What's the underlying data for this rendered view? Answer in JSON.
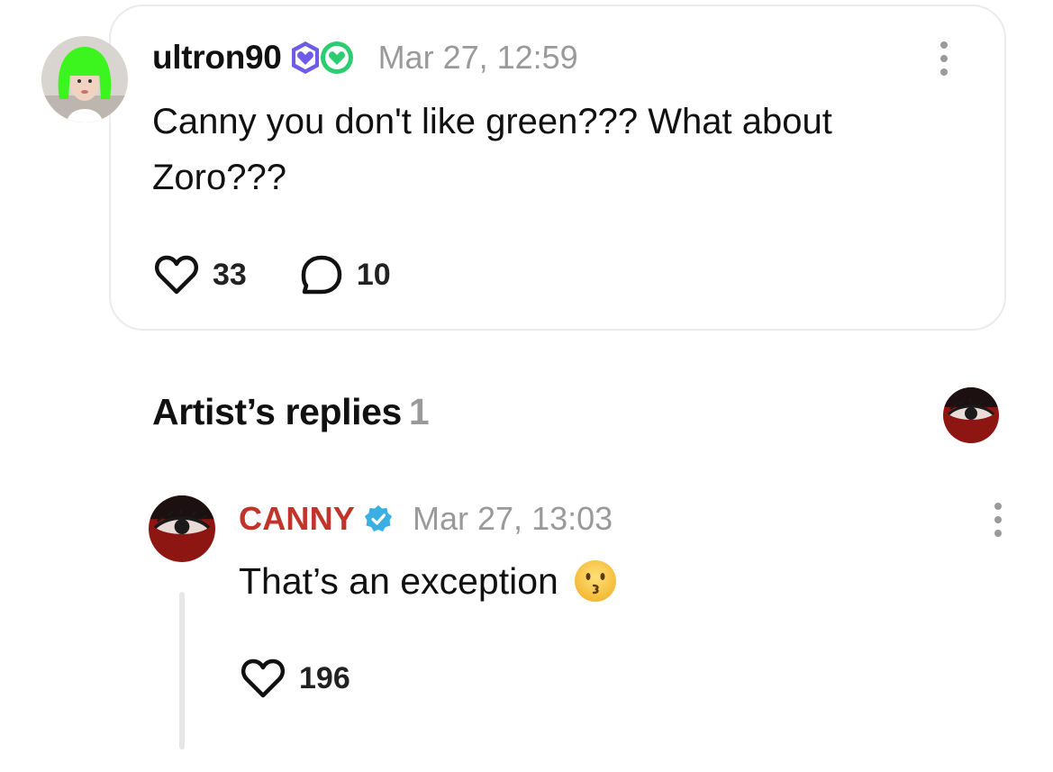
{
  "comment": {
    "username": "ultron90",
    "timestamp": "Mar 27, 12:59",
    "text": "Canny you don't like green??? What about Zoro???",
    "likes": "33",
    "replies": "10",
    "badge_colors": [
      "#6c5ce7",
      "#2ecc71"
    ],
    "avatar_hair_color": "#3df51e"
  },
  "artist_replies": {
    "heading": "Artist’s replies",
    "count": "1"
  },
  "reply": {
    "username": "CANNY",
    "username_color": "#c2342a",
    "verified_color": "#3ab0e2",
    "timestamp": "Mar 27, 13:03",
    "text": "That’s an exception",
    "emoji": "kissing-face",
    "likes": "196"
  },
  "icons": {
    "like": "heart-outline-icon",
    "reply": "speech-bubble-icon",
    "more": "more-vertical-icon"
  }
}
